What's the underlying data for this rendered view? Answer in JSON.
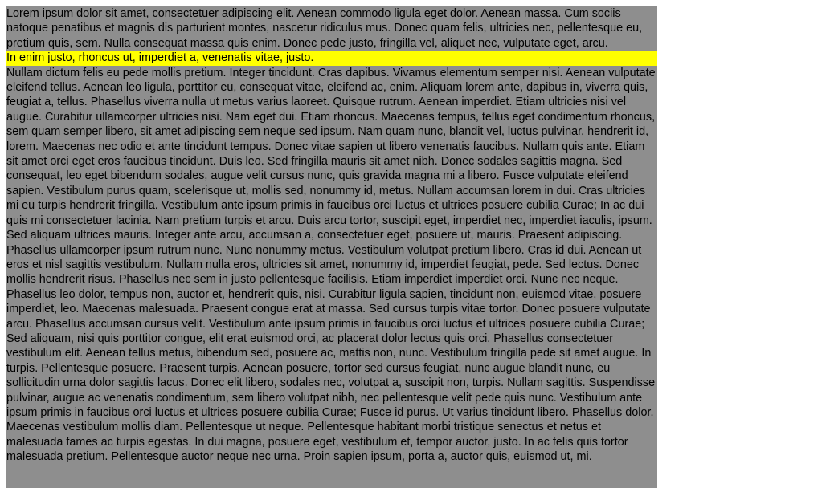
{
  "document": {
    "paragraph_before": "Lorem ipsum dolor sit amet, consectetuer adipiscing elit. Aenean commodo ligula eget dolor. Aenean massa. Cum sociis natoque penatibus et magnis dis parturient montes, nascetur ridiculus mus. Donec quam felis, ultricies nec, pellentesque eu, pretium quis, sem. Nulla consequat massa quis enim. Donec pede justo, fringilla vel, aliquet nec, vulputate eget, arcu.",
    "highlighted_line": "In enim justo, rhoncus ut, imperdiet a, venenatis vitae, justo.",
    "paragraph_after": "Nullam dictum felis eu pede mollis pretium. Integer tincidunt. Cras dapibus. Vivamus elementum semper nisi. Aenean vulputate eleifend tellus. Aenean leo ligula, porttitor eu, consequat vitae, eleifend ac, enim. Aliquam lorem ante, dapibus in, viverra quis, feugiat a, tellus. Phasellus viverra nulla ut metus varius laoreet. Quisque rutrum. Aenean imperdiet. Etiam ultricies nisi vel augue. Curabitur ullamcorper ultricies nisi. Nam eget dui. Etiam rhoncus. Maecenas tempus, tellus eget condimentum rhoncus, sem quam semper libero, sit amet adipiscing sem neque sed ipsum. Nam quam nunc, blandit vel, luctus pulvinar, hendrerit id, lorem. Maecenas nec odio et ante tincidunt tempus. Donec vitae sapien ut libero venenatis faucibus. Nullam quis ante. Etiam sit amet orci eget eros faucibus tincidunt. Duis leo. Sed fringilla mauris sit amet nibh. Donec sodales sagittis magna. Sed consequat, leo eget bibendum sodales, augue velit cursus nunc, quis gravida magna mi a libero. Fusce vulputate eleifend sapien. Vestibulum purus quam, scelerisque ut, mollis sed, nonummy id, metus. Nullam accumsan lorem in dui. Cras ultricies mi eu turpis hendrerit fringilla. Vestibulum ante ipsum primis in faucibus orci luctus et ultrices posuere cubilia Curae; In ac dui quis mi consectetuer lacinia. Nam pretium turpis et arcu. Duis arcu tortor, suscipit eget, imperdiet nec, imperdiet iaculis, ipsum. Sed aliquam ultrices mauris. Integer ante arcu, accumsan a, consectetuer eget, posuere ut, mauris. Praesent adipiscing. Phasellus ullamcorper ipsum rutrum nunc. Nunc nonummy metus. Vestibulum volutpat pretium libero. Cras id dui. Aenean ut eros et nisl sagittis vestibulum. Nullam nulla eros, ultricies sit amet, nonummy id, imperdiet feugiat, pede. Sed lectus. Donec mollis hendrerit risus. Phasellus nec sem in justo pellentesque facilisis. Etiam imperdiet imperdiet orci. Nunc nec neque. Phasellus leo dolor, tempus non, auctor et, hendrerit quis, nisi. Curabitur ligula sapien, tincidunt non, euismod vitae, posuere imperdiet, leo. Maecenas malesuada. Praesent congue erat at massa. Sed cursus turpis vitae tortor. Donec posuere vulputate arcu. Phasellus accumsan cursus velit. Vestibulum ante ipsum primis in faucibus orci luctus et ultrices posuere cubilia Curae; Sed aliquam, nisi quis porttitor congue, elit erat euismod orci, ac placerat dolor lectus quis orci. Phasellus consectetuer vestibulum elit. Aenean tellus metus, bibendum sed, posuere ac, mattis non, nunc. Vestibulum fringilla pede sit amet augue. In turpis. Pellentesque posuere. Praesent turpis. Aenean posuere, tortor sed cursus feugiat, nunc augue blandit nunc, eu sollicitudin urna dolor sagittis lacus. Donec elit libero, sodales nec, volutpat a, suscipit non, turpis. Nullam sagittis. Suspendisse pulvinar, augue ac venenatis condimentum, sem libero volutpat nibh, nec pellentesque velit pede quis nunc. Vestibulum ante ipsum primis in faucibus orci luctus et ultrices posuere cubilia Curae; Fusce id purus. Ut varius tincidunt libero. Phasellus dolor. Maecenas vestibulum mollis diam. Pellentesque ut neque. Pellentesque habitant morbi tristique senectus et netus et malesuada fames ac turpis egestas. In dui magna, posuere eget, vestibulum et, tempor auctor, justo. In ac felis quis tortor malesuada pretium. Pellentesque auctor neque nec urna. Proin sapien ipsum, porta a, auctor quis, euismod ut, mi."
  },
  "colors": {
    "page_background": "#ffffff",
    "text_area_background": "#8e8e8e",
    "highlight": "#ffff00",
    "text": "#000000"
  }
}
